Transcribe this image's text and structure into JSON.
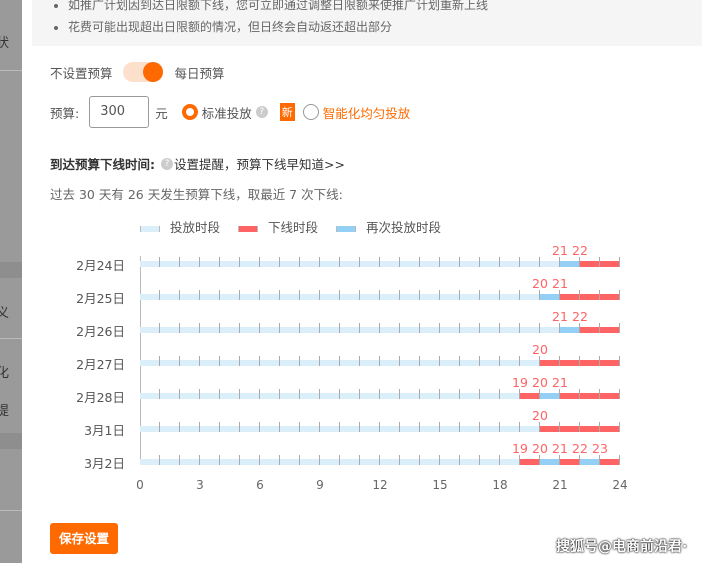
{
  "left_fragments": [
    "状",
    "义",
    "化",
    "提"
  ],
  "notice": [
    "如推广计划因到达日限额下线，您可立即通过调整日限额来使推广计划重新上线",
    "花费可能出现超出日限额的情况，但日终会自动返还超出部分"
  ],
  "budget_toggle": {
    "off_label": "不设置预算",
    "on_label": "每日预算",
    "on": true
  },
  "budget": {
    "label": "预算:",
    "value": "300",
    "unit": "元"
  },
  "delivery": {
    "standard": "标准投放",
    "new_badge": "新",
    "smart": "智能化均匀投放",
    "selected": "standard"
  },
  "offline": {
    "title": "到达预算下线时间:",
    "link": "设置提醒，预算下线早知道>>",
    "summary": "过去 30 天有 26 天发生预算下线，取最近 7 次下线:"
  },
  "colors": {
    "accent": "#ff6a00",
    "delivering": "#dbeffa",
    "offline": "#ff6464",
    "redelivering": "#94d0f5"
  },
  "chart_data": {
    "type": "timeline",
    "legend": [
      "投放时段",
      "下线时段",
      "再次投放时段"
    ],
    "x_ticks": [
      0,
      3,
      6,
      9,
      12,
      15,
      18,
      21,
      24
    ],
    "xlim": [
      0,
      24
    ],
    "rows": [
      {
        "date": "2月24日",
        "labels": [
          "21",
          "22"
        ],
        "segments": [
          [
            0,
            21,
            "delivering"
          ],
          [
            21,
            22,
            "redelivering"
          ],
          [
            22,
            24,
            "offline"
          ]
        ]
      },
      {
        "date": "2月25日",
        "labels": [
          "20",
          "21"
        ],
        "segments": [
          [
            0,
            20,
            "delivering"
          ],
          [
            20,
            21,
            "redelivering"
          ],
          [
            21,
            24,
            "offline"
          ]
        ]
      },
      {
        "date": "2月26日",
        "labels": [
          "21",
          "22"
        ],
        "segments": [
          [
            0,
            21,
            "delivering"
          ],
          [
            21,
            22,
            "redelivering"
          ],
          [
            22,
            24,
            "offline"
          ]
        ]
      },
      {
        "date": "2月27日",
        "labels": [
          "20"
        ],
        "segments": [
          [
            0,
            20,
            "delivering"
          ],
          [
            20,
            24,
            "offline"
          ]
        ]
      },
      {
        "date": "2月28日",
        "labels": [
          "19",
          "20",
          "21"
        ],
        "segments": [
          [
            0,
            19,
            "delivering"
          ],
          [
            19,
            20,
            "offline"
          ],
          [
            20,
            21,
            "redelivering"
          ],
          [
            21,
            24,
            "offline"
          ]
        ]
      },
      {
        "date": "3月1日",
        "labels": [
          "20"
        ],
        "segments": [
          [
            0,
            20,
            "delivering"
          ],
          [
            20,
            24,
            "offline"
          ]
        ]
      },
      {
        "date": "3月2日",
        "labels": [
          "19",
          "20",
          "21",
          "22",
          "23"
        ],
        "segments": [
          [
            0,
            19,
            "delivering"
          ],
          [
            19,
            20,
            "offline"
          ],
          [
            20,
            21,
            "redelivering"
          ],
          [
            21,
            22,
            "offline"
          ],
          [
            22,
            23,
            "redelivering"
          ],
          [
            23,
            24,
            "offline"
          ]
        ]
      }
    ]
  },
  "save_button": "保存设置",
  "watermark": "搜狐号@电商前沿君·"
}
